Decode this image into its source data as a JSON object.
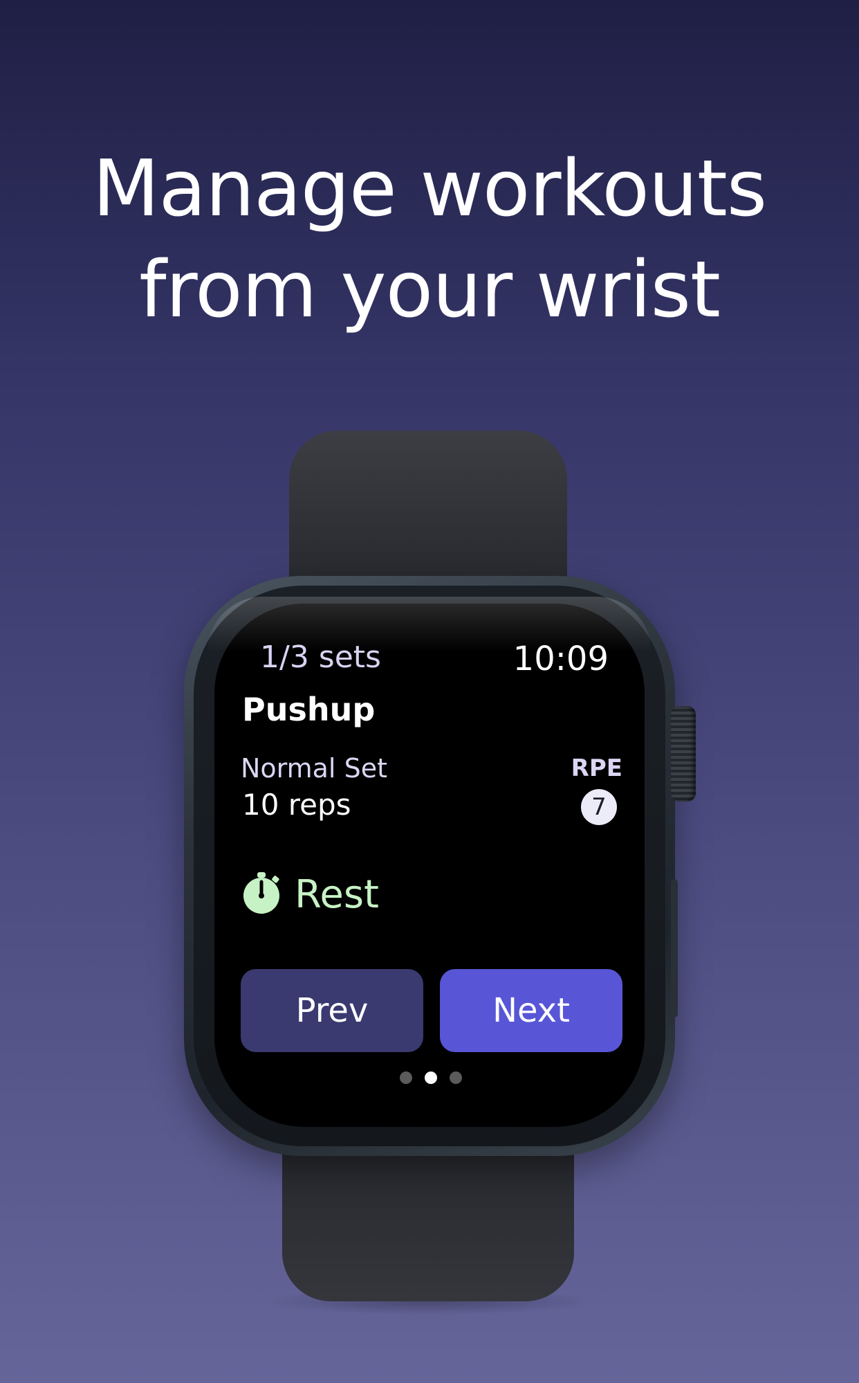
{
  "headline": {
    "line1": "Manage workouts",
    "line2": "from your wrist"
  },
  "watch": {
    "sets_label": "1/3 sets",
    "time": "10:09",
    "exercise_name": "Pushup",
    "set_type": "Normal Set",
    "reps": "10 reps",
    "rpe_label": "RPE",
    "rpe_value": "7",
    "rest_label": "Rest",
    "rest_icon": "stopwatch-icon",
    "buttons": {
      "prev": "Prev",
      "next": "Next"
    },
    "page_indicator": {
      "total": 3,
      "active": 2
    }
  },
  "colors": {
    "background_top": "#1f1f45",
    "background_bottom": "#65659a",
    "prev_button": "#3a3a70",
    "next_button": "#5856d6",
    "rest_accent": "#c7f2c5"
  }
}
